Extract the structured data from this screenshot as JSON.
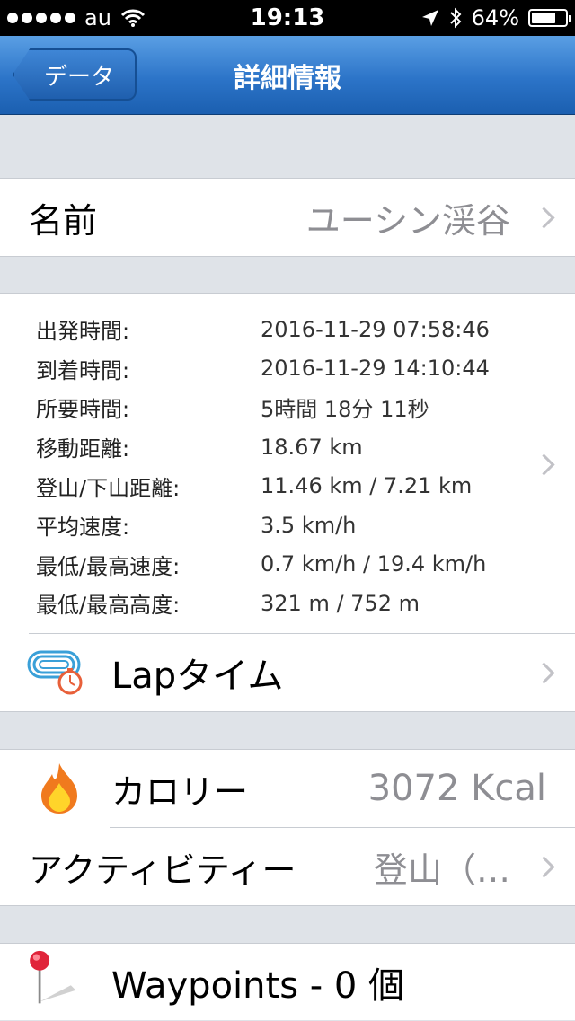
{
  "status_bar": {
    "carrier": "au",
    "time": "19:13",
    "battery": "64%",
    "battery_level": 0.64
  },
  "nav": {
    "back_label": "データ",
    "title": "詳細情報"
  },
  "name_row": {
    "label": "名前",
    "value": "ユーシン渓谷"
  },
  "details": [
    {
      "key": "出発時間:",
      "value": "2016-11-29 07:58:46"
    },
    {
      "key": "到着時間:",
      "value": "2016-11-29 14:10:44"
    },
    {
      "key": "所要時間:",
      "value": "5時間 18分 11秒"
    },
    {
      "key": "移動距離:",
      "value": "18.67 km"
    },
    {
      "key": "登山/下山距離:",
      "value": "11.46 km / 7.21 km"
    },
    {
      "key": "平均速度:",
      "value": "3.5 km/h"
    },
    {
      "key": "最低/最高速度:",
      "value": "0.7 km/h / 19.4 km/h"
    },
    {
      "key": "最低/最高高度:",
      "value": "321 m / 752 m"
    }
  ],
  "lap_row": {
    "label": "Lapタイム"
  },
  "calorie_row": {
    "label": "カロリー",
    "value": "3072 Kcal"
  },
  "activity_row": {
    "label": "アクティビティー",
    "value": "登山（…"
  },
  "waypoints_row": {
    "label": "Waypoints - 0 個"
  },
  "colors": {
    "nav_blue": "#2c74c8",
    "background": "#dfe3e8",
    "secondary_text": "#8e8e93"
  }
}
